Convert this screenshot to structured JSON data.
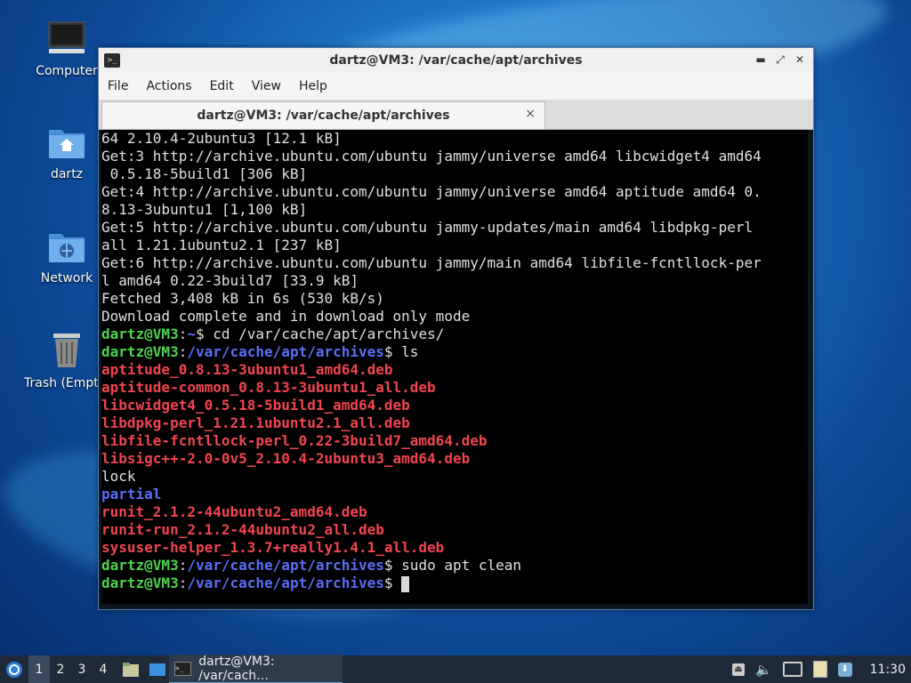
{
  "desktop": {
    "icons": [
      {
        "label": "Computer"
      },
      {
        "label": "dartz"
      },
      {
        "label": "Network"
      },
      {
        "label": "Trash (Empty)"
      }
    ]
  },
  "window": {
    "title": "dartz@VM3: /var/cache/apt/archives",
    "menu": [
      "File",
      "Actions",
      "Edit",
      "View",
      "Help"
    ],
    "tab_title": "dartz@VM3: /var/cache/apt/archives",
    "close_glyph": "×"
  },
  "terminal": {
    "lines": [
      [
        {
          "t": "64 2.10.4-2ubuntu3 [12.1 kB]",
          "c": "w"
        }
      ],
      [
        {
          "t": "Get:3 http://archive.ubuntu.com/ubuntu jammy/universe amd64 libcwidget4 amd64",
          "c": "w"
        }
      ],
      [
        {
          "t": " 0.5.18-5build1 [306 kB]",
          "c": "w"
        }
      ],
      [
        {
          "t": "Get:4 http://archive.ubuntu.com/ubuntu jammy/universe amd64 aptitude amd64 0.",
          "c": "w"
        }
      ],
      [
        {
          "t": "8.13-3ubuntu1 [1,100 kB]",
          "c": "w"
        }
      ],
      [
        {
          "t": "Get:5 http://archive.ubuntu.com/ubuntu jammy-updates/main amd64 libdpkg-perl",
          "c": "w"
        }
      ],
      [
        {
          "t": "all 1.21.1ubuntu2.1 [237 kB]",
          "c": "w"
        }
      ],
      [
        {
          "t": "Get:6 http://archive.ubuntu.com/ubuntu jammy/main amd64 libfile-fcntllock-per",
          "c": "w"
        }
      ],
      [
        {
          "t": "l amd64 0.22-3build7 [33.9 kB]",
          "c": "w"
        }
      ],
      [
        {
          "t": "Fetched 3,408 kB in 6s (530 kB/s)",
          "c": "w"
        }
      ],
      [
        {
          "t": "Download complete and in download only mode",
          "c": "w"
        }
      ],
      [
        {
          "t": "dartz@VM3",
          "c": "g"
        },
        {
          "t": ":",
          "c": "w"
        },
        {
          "t": "~",
          "c": "b"
        },
        {
          "t": "$ cd /var/cache/apt/archives/",
          "c": "w"
        }
      ],
      [
        {
          "t": "dartz@VM3",
          "c": "g"
        },
        {
          "t": ":",
          "c": "w"
        },
        {
          "t": "/var/cache/apt/archives",
          "c": "b"
        },
        {
          "t": "$ ls",
          "c": "w"
        }
      ],
      [
        {
          "t": "aptitude_0.8.13-3ubuntu1_amd64.deb",
          "c": "r"
        }
      ],
      [
        {
          "t": "aptitude-common_0.8.13-3ubuntu1_all.deb",
          "c": "r"
        }
      ],
      [
        {
          "t": "libcwidget4_0.5.18-5build1_amd64.deb",
          "c": "r"
        }
      ],
      [
        {
          "t": "libdpkg-perl_1.21.1ubuntu2.1_all.deb",
          "c": "r"
        }
      ],
      [
        {
          "t": "libfile-fcntllock-perl_0.22-3build7_amd64.deb",
          "c": "r"
        }
      ],
      [
        {
          "t": "libsigc++-2.0-0v5_2.10.4-2ubuntu3_amd64.deb",
          "c": "r"
        }
      ],
      [
        {
          "t": "lock",
          "c": "w"
        }
      ],
      [
        {
          "t": "partial",
          "c": "b"
        }
      ],
      [
        {
          "t": "runit_2.1.2-44ubuntu2_amd64.deb",
          "c": "r"
        }
      ],
      [
        {
          "t": "runit-run_2.1.2-44ubuntu2_all.deb",
          "c": "r"
        }
      ],
      [
        {
          "t": "sysuser-helper_1.3.7+really1.4.1_all.deb",
          "c": "r"
        }
      ],
      [
        {
          "t": "dartz@VM3",
          "c": "g"
        },
        {
          "t": ":",
          "c": "w"
        },
        {
          "t": "/var/cache/apt/archives",
          "c": "b"
        },
        {
          "t": "$ sudo apt clean",
          "c": "w"
        }
      ],
      [
        {
          "t": "dartz@VM3",
          "c": "g"
        },
        {
          "t": ":",
          "c": "w"
        },
        {
          "t": "/var/cache/apt/archives",
          "c": "b"
        },
        {
          "t": "$ ",
          "c": "w"
        }
      ]
    ]
  },
  "taskbar": {
    "workspaces": [
      "1",
      "2",
      "3",
      "4"
    ],
    "active_workspace": "1",
    "task_label": "dartz@VM3: /var/cach…",
    "clock": "11:30"
  },
  "colors": {
    "prompt_user": "#4fd250",
    "prompt_path": "#5b6ef5",
    "deb_file": "#f0454f"
  }
}
